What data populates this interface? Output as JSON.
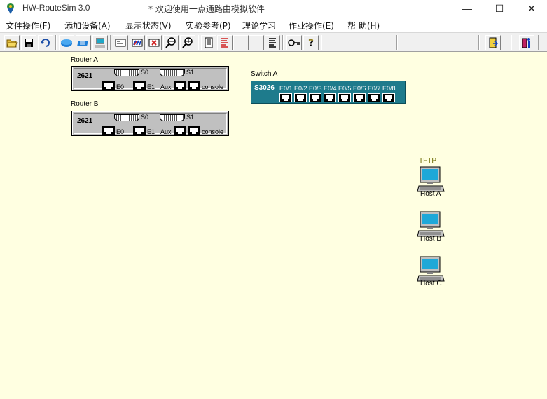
{
  "window": {
    "app_title": "HW-RouteSim 3.0",
    "doc_title": "* 欢迎使用一点通路由模拟软件",
    "minimize": "—",
    "maximize": "☐",
    "close": "✕"
  },
  "menu": [
    {
      "label": "文件操作(F)"
    },
    {
      "label": "添加设备(A)"
    },
    {
      "label": "显示状态(V)"
    },
    {
      "label": "实验参考(P)"
    },
    {
      "label": "理论学习"
    },
    {
      "label": "作业操作(E)"
    },
    {
      "label": "帮  助(H)"
    }
  ],
  "toolbar": {
    "buttons": [
      {
        "icon": "open-folder-icon"
      },
      {
        "icon": "save-icon"
      },
      {
        "icon": "refresh-icon"
      },
      {
        "icon": "router-icon"
      },
      {
        "icon": "switch-icon"
      },
      {
        "icon": "host-icon"
      },
      {
        "icon": "terminal-icon"
      },
      {
        "icon": "connect-icon"
      },
      {
        "icon": "delete-connection-icon"
      },
      {
        "icon": "zoom-out-icon"
      },
      {
        "icon": "zoom-in-icon"
      },
      {
        "icon": "document-icon"
      },
      {
        "icon": "report-icon"
      },
      {
        "icon": "list-icon"
      },
      {
        "icon": "key-icon"
      },
      {
        "icon": "help-icon"
      },
      {
        "icon": "exit-icon"
      },
      {
        "icon": "info-icon"
      }
    ]
  },
  "routers": [
    {
      "label": "Router A",
      "model": "2621",
      "serial_ports": [
        "S0",
        "S1"
      ],
      "ports": [
        "E0",
        "E1",
        "Aux",
        "console"
      ]
    },
    {
      "label": "Router  B",
      "model": "2621",
      "serial_ports": [
        "S0",
        "S1"
      ],
      "ports": [
        "E0",
        "E1",
        "Aux",
        "console"
      ]
    }
  ],
  "switch": {
    "label": "Switch A",
    "model": "S3026",
    "ports": [
      "E0/1",
      "E0/2",
      "E0/3",
      "E0/4",
      "E0/5",
      "E0/6",
      "E0/7",
      "E0/8"
    ]
  },
  "hosts": [
    {
      "label": "Host A",
      "role": "TFTP"
    },
    {
      "label": "Host B"
    },
    {
      "label": "Host C"
    }
  ],
  "colors": {
    "workspace": "#ffffe1",
    "switch_body": "#1e7b8c",
    "router_body": "#c0c0c0"
  }
}
